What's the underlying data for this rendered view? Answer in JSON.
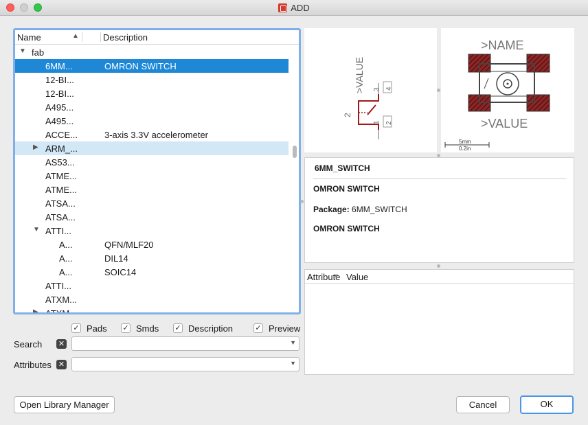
{
  "window": {
    "title": "ADD"
  },
  "tree": {
    "headers": {
      "name": "Name",
      "description": "Description"
    },
    "library": "fab",
    "rows": [
      {
        "name": "6MM...",
        "desc": "OMRON SWITCH"
      },
      {
        "name": "12-BI...",
        "desc": ""
      },
      {
        "name": "12-BI...",
        "desc": ""
      },
      {
        "name": "A495...",
        "desc": ""
      },
      {
        "name": "A495...",
        "desc": ""
      },
      {
        "name": "ACCE...",
        "desc": "3-axis 3.3V accelerometer"
      },
      {
        "name": "ARM_...",
        "desc": ""
      },
      {
        "name": "AS53...",
        "desc": ""
      },
      {
        "name": "ATME...",
        "desc": ""
      },
      {
        "name": "ATME...",
        "desc": ""
      },
      {
        "name": "ATSA...",
        "desc": ""
      },
      {
        "name": "ATSA...",
        "desc": ""
      },
      {
        "name": "ATTI...",
        "desc": ""
      },
      {
        "name": "A...",
        "desc": "QFN/MLF20"
      },
      {
        "name": "A...",
        "desc": "DIL14"
      },
      {
        "name": "A...",
        "desc": "SOIC14"
      },
      {
        "name": "ATTI...",
        "desc": ""
      },
      {
        "name": "ATXM...",
        "desc": ""
      },
      {
        "name": "ATXM...",
        "desc": ""
      }
    ]
  },
  "filters": {
    "pads": "Pads",
    "smds": "Smds",
    "description": "Description",
    "preview": "Preview",
    "search_label": "Search",
    "attributes_label": "Attributes"
  },
  "symbol": {
    "value": ">VALUE",
    "pin1": "1",
    "pin2": "2",
    "pin3": "3",
    "pin4": "4",
    "side_pin": "2"
  },
  "package": {
    "name": ">NAME",
    "value": ">VALUE",
    "scale_mm": "5mm",
    "scale_in": "0.2in"
  },
  "info": {
    "title": "6MM_SWITCH",
    "line1": "OMRON SWITCH",
    "package_label": "Package:",
    "package_value": "6MM_SWITCH",
    "line3": "OMRON SWITCH"
  },
  "attributes": {
    "col1": "Attribute",
    "col2": "Value"
  },
  "buttons": {
    "library_manager": "Open Library Manager",
    "cancel": "Cancel",
    "ok": "OK"
  }
}
